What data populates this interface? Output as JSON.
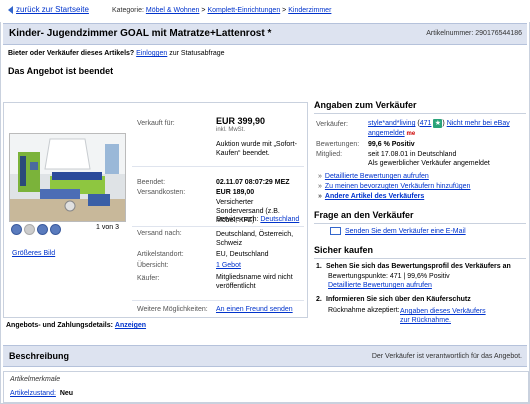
{
  "nav": {
    "back_label": "zurück zur Startseite",
    "category_label": "Kategorie:",
    "crumbs": [
      "Möbel & Wohnen",
      "Komplett-Einrichtungen",
      "Kinderzimmer"
    ],
    "sep": ">"
  },
  "listing": {
    "title": "Kinder- Jugendzimmer GOAL mit Matratze+Lattenrost *",
    "article_number": "Artikelnummer: 290176544186",
    "bidder_question": "Bieter oder Verkäufer dieses Artikels?",
    "login_link": "Einloggen",
    "login_suffix": "zur Statusabfrage",
    "ended": "Das Angebot ist beendet"
  },
  "gallery": {
    "counter": "1 von 3",
    "bigger_link": "Größeres Bild"
  },
  "details": {
    "sold_for_label": "Verkauft für:",
    "price": "EUR 399,90",
    "vat": "inkl. MwSt.",
    "sofort_note": "Auktion wurde mit „Sofort-Kaufen“ beendet.",
    "ended_label": "Beendet:",
    "ended_value": "02.11.07 08:07:29 MEZ",
    "shipping_label": "Versandkosten:",
    "shipping_price": "EUR 189,00",
    "shipping_desc": "Versicherter Sonderversand (z.B. Möbel, KFZ)",
    "service_label": "Service nach:",
    "service_link": "Deutschland",
    "ship_to_label": "Versand nach:",
    "ship_to_value": "Deutschland, Österreich, Schweiz",
    "location_label": "Artikelstandort:",
    "location_value": "EU, Deutschland",
    "overview_label": "Übersicht:",
    "overview_value": "1 Gebot",
    "buyer_label": "Käufer:",
    "buyer_value": "Mitgliedsname wird nicht veröffentlicht",
    "more_label": "Weitere Möglichkeiten:",
    "more_link": "An einen Freund senden"
  },
  "seller": {
    "heading": "Angaben zum Verkäufer",
    "seller_label": "Verkäufer:",
    "seller_name": "style*and*living",
    "rating_link": "471",
    "star_icon_text": "★",
    "no_longer_link": "Nicht mehr bei eBay angemeldet",
    "me_badge": "me",
    "ratings_label": "Bewertungen:",
    "ratings_value": "99,6 % Positiv",
    "member_label": "Mitglied:",
    "member_value": "seit 17.08.01 in Deutschland",
    "member_sub": "Als gewerblicher Verkäufer angemeldet",
    "links": [
      "Detaillierte Bewertungen aufrufen",
      "Zu meinen bevorzugten Verkäufern hinzufügen",
      "Andere Artikel des Verkäufers"
    ]
  },
  "question": {
    "heading": "Frage an den Verkäufer",
    "mail_link": "Senden Sie dem Verkäufer eine E-Mail"
  },
  "safe": {
    "heading": "Sicher kaufen",
    "step1_num": "1.",
    "step1": "Sehen Sie sich das Bewertungsprofil des Verkäufers an",
    "step1_detail": "Bewertungspunkte: 471 | 99,6% Positiv",
    "step1_link": "Detaillierte Bewertungen aufrufen",
    "step2_num": "2.",
    "step2": "Informieren Sie sich über den Käuferschutz",
    "returns_label": "Rücknahme akzeptiert:",
    "returns_link": "Angaben dieses Verkäufers zur Rücknahme."
  },
  "bottom": {
    "payment_label": "Angebots- und Zahlungsdetails:",
    "payment_link": "Anzeigen"
  },
  "description": {
    "heading": "Beschreibung",
    "responsibility": "Der Verkäufer ist verantwortlich für das Angebot.",
    "features_title": "Artikelmerkmale",
    "condition_label": "Artikelzustand:",
    "condition_value": "Neu"
  },
  "colors": {
    "accent": "#0033cc",
    "header_bg": "#dde3f0",
    "border": "#c9d1de"
  }
}
